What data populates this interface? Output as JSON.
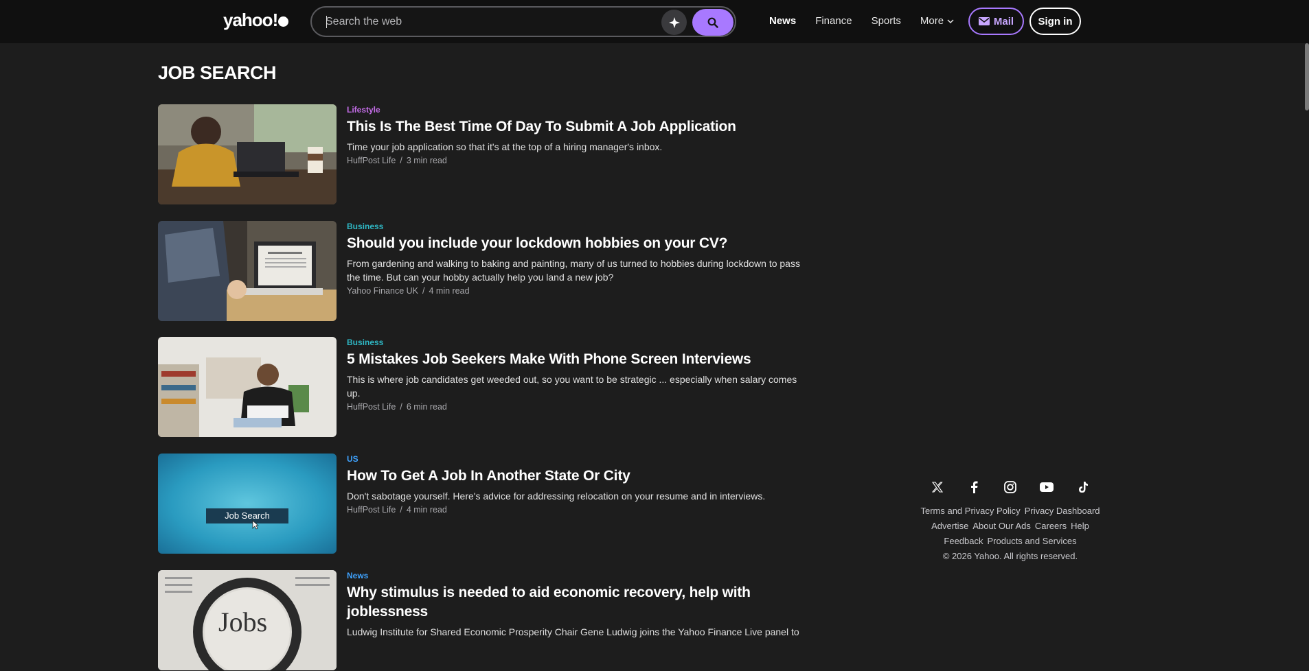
{
  "header": {
    "logo_text": "yahoo!",
    "search_placeholder": "Search the web",
    "nav": [
      {
        "label": "News"
      },
      {
        "label": "Finance"
      },
      {
        "label": "Sports"
      },
      {
        "label": "More"
      }
    ],
    "mail_label": "Mail",
    "signin_label": "Sign in",
    "accent_color": "#a879ff"
  },
  "page_title": "JOB SEARCH",
  "articles": [
    {
      "category": "Lifestyle",
      "category_color": "#c46de8",
      "title": "This Is The Best Time Of Day To Submit A Job Application",
      "summary": "Time your job application so that it's at the top of a hiring manager's inbox.",
      "source": "HuffPost Life",
      "read_time": "3 min read"
    },
    {
      "category": "Business",
      "category_color": "#2fb8c5",
      "title": "Should you include your lockdown hobbies on your CV?",
      "summary": "From gardening and walking to baking and painting, many of us turned to hobbies during lockdown to pass the time. But can your hobby actually help you land a new job?",
      "source": "Yahoo Finance UK",
      "read_time": "4 min read"
    },
    {
      "category": "Business",
      "category_color": "#2fb8c5",
      "title": "5 Mistakes Job Seekers Make With Phone Screen Interviews",
      "summary": "This is where job candidates get weeded out, so you want to be strategic ... especially when salary comes up.",
      "source": "HuffPost Life",
      "read_time": "6 min read"
    },
    {
      "category": "US",
      "category_color": "#3fa3ff",
      "title": "How To Get A Job In Another State Or City",
      "summary": "Don't sabotage yourself. Here's advice for addressing relocation on your resume and in interviews.",
      "source": "HuffPost Life",
      "read_time": "4 min read",
      "thumb_text": "Job Search"
    },
    {
      "category": "News",
      "category_color": "#3fa3ff",
      "title": "Why stimulus is needed to aid economic recovery, help with joblessness",
      "summary": "Ludwig Institute for Shared Economic Prosperity Chair Gene Ludwig joins the Yahoo Finance Live panel to",
      "source": "",
      "read_time": "",
      "thumb_text": "Jobs"
    }
  ],
  "footer": {
    "social_icons": [
      "x-icon",
      "facebook-icon",
      "instagram-icon",
      "youtube-icon",
      "tiktok-icon"
    ],
    "row1": [
      "Terms and Privacy Policy",
      "Privacy Dashboard"
    ],
    "row2": [
      "Advertise",
      "About Our Ads",
      "Careers",
      "Help"
    ],
    "row3": [
      "Feedback",
      "Products and Services"
    ],
    "copyright": "© 2026 Yahoo. All rights reserved."
  }
}
